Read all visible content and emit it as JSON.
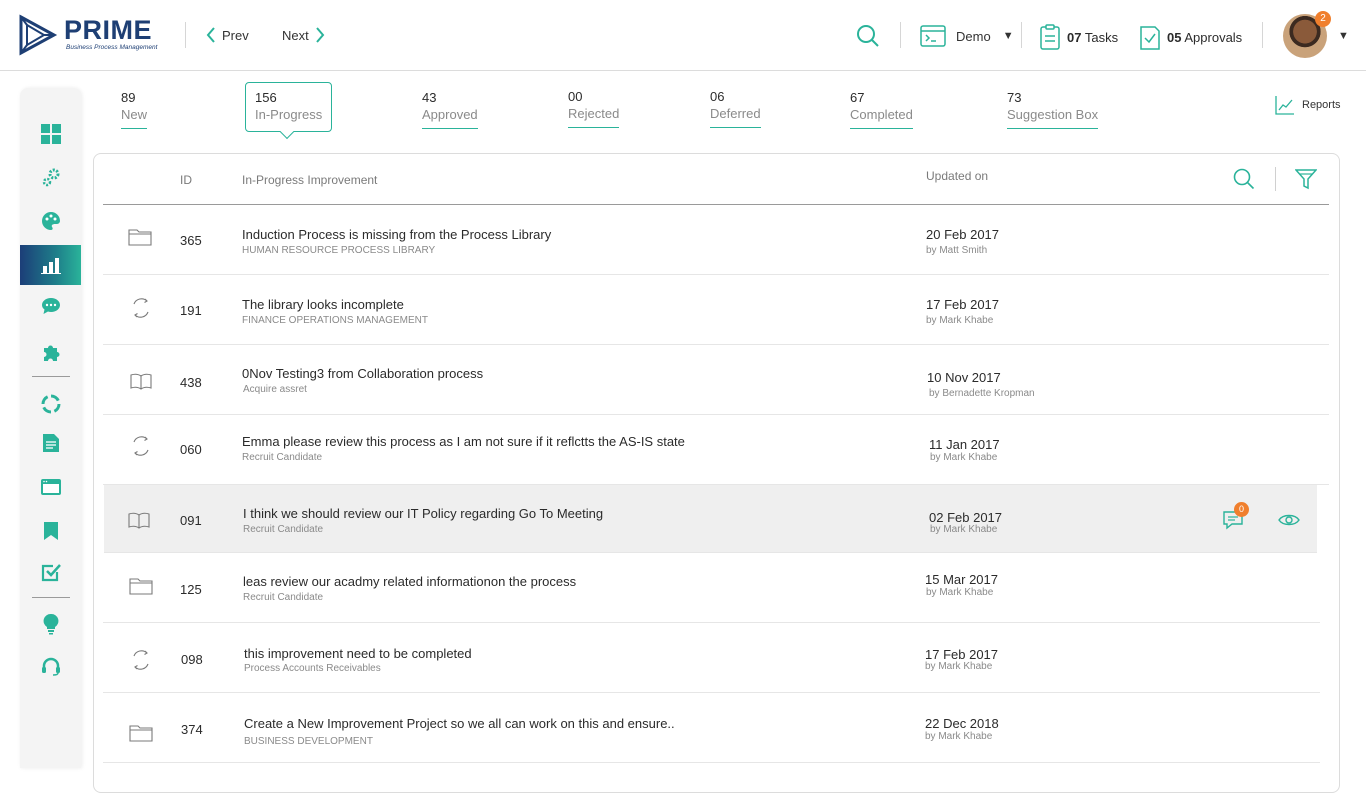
{
  "brand": {
    "name": "PRIME",
    "tagline": "Business Process Management",
    "primary": "#1e3f74",
    "accent": "#2ab39a",
    "badge": "#f07f2d"
  },
  "header": {
    "prev_label": "Prev",
    "next_label": "Next",
    "workspace": "Demo",
    "tasks_count": "07",
    "tasks_label": "Tasks",
    "approvals_count": "05",
    "approvals_label": "Approvals",
    "notification_count": "2"
  },
  "sidebar": {
    "items": [
      {
        "icon": "dashboard-icon"
      },
      {
        "icon": "settings-gears-icon"
      },
      {
        "icon": "palette-icon"
      },
      {
        "icon": "bar-chart-icon",
        "active": true
      },
      {
        "icon": "chat-icon"
      },
      {
        "icon": "puzzle-icon"
      },
      {
        "icon": "cycle-icon"
      },
      {
        "icon": "document-icon"
      },
      {
        "icon": "browser-window-icon"
      },
      {
        "icon": "bookmark-icon"
      },
      {
        "icon": "checkbox-icon"
      },
      {
        "icon": "lightbulb-icon"
      },
      {
        "icon": "headset-icon"
      }
    ]
  },
  "stats": [
    {
      "count": "89",
      "label": "New"
    },
    {
      "count": "156",
      "label": "In-Progress",
      "active": true
    },
    {
      "count": "43",
      "label": "Approved"
    },
    {
      "count": "00",
      "label": "Rejected"
    },
    {
      "count": "06",
      "label": "Deferred"
    },
    {
      "count": "67",
      "label": "Completed"
    },
    {
      "count": "73",
      "label": "Suggestion Box"
    }
  ],
  "reports_label": "Reports",
  "table": {
    "headers": {
      "id": "ID",
      "title": "In-Progress Improvement",
      "updated": "Updated on"
    },
    "rows": [
      {
        "icon": "folder-icon",
        "id": "365",
        "title": "Induction Process is missing from the Process Library",
        "subtitle": "HUMAN RESOURCE PROCESS LIBRARY",
        "date": "20 Feb 2017",
        "by": "by Matt Smith"
      },
      {
        "icon": "cycle-icon",
        "id": "191",
        "title": "The library looks incomplete",
        "subtitle": "FINANCE OPERATIONS MANAGEMENT",
        "date": "17 Feb 2017",
        "by": "by Mark Khabe"
      },
      {
        "icon": "book-icon",
        "id": "438",
        "title": "0Nov Testing3 from Collaboration process",
        "subtitle": "Acquire assret",
        "date": "10 Nov 2017",
        "by": "by Bernadette Kropman"
      },
      {
        "icon": "cycle-icon",
        "id": "060",
        "title": "Emma please review this process as I am not sure if it reflctts the AS-IS state",
        "subtitle": "Recruit Candidate",
        "date": "11 Jan 2017",
        "by": "by Mark Khabe"
      },
      {
        "icon": "book-icon",
        "id": "091",
        "title": "I think we should review our IT Policy regarding Go To Meeting",
        "subtitle": "Recruit Candidate",
        "date": "02 Feb 2017",
        "by": "by Mark Khabe",
        "highlighted": true,
        "comment_count": "0"
      },
      {
        "icon": "folder-icon",
        "id": "125",
        "title": "leas review our acadmy related informationon the process",
        "subtitle": "Recruit Candidate",
        "date": "15 Mar 2017",
        "by": "by Mark Khabe"
      },
      {
        "icon": "cycle-icon",
        "id": "098",
        "title": "this improvement need to be completed",
        "subtitle": "Process Accounts Receivables",
        "date": "17 Feb 2017",
        "by": "by Mark Khabe"
      },
      {
        "icon": "folder-icon",
        "id": "374",
        "title": "Create a New Improvement Project so we all can work on this and ensure..",
        "subtitle": "BUSINESS DEVELOPMENT",
        "date": "22 Dec 2018",
        "by": "by Mark Khabe"
      }
    ]
  }
}
